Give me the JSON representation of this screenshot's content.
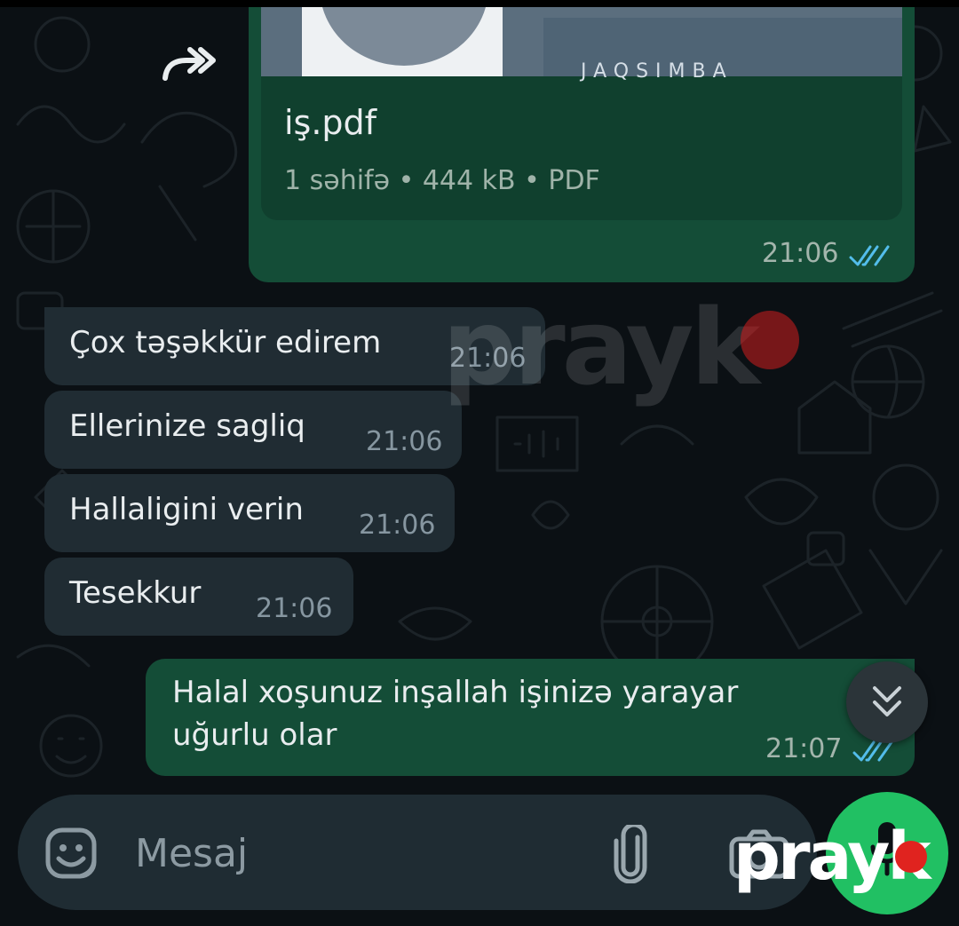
{
  "colors": {
    "background": "#0b1014",
    "outgoing_bubble": "#144d37",
    "incoming_bubble": "#202c33",
    "read_ticks": "#53bdeb",
    "mic_button": "#21c063",
    "watermark_dot": "#e0231f"
  },
  "forwarded_file": {
    "icon": "forward-icon",
    "preview_text": "JAQSIMBA",
    "file_name": "iş.pdf",
    "file_meta": "1 səhifə • 444 kB • PDF",
    "time": "21:06",
    "status": "read"
  },
  "messages": [
    {
      "direction": "in",
      "text": "Çox təşəkkür edirem",
      "time": "21:06"
    },
    {
      "direction": "in",
      "text": "Ellerinize sagliq",
      "time": "21:06"
    },
    {
      "direction": "in",
      "text": "Hallaligini verin",
      "time": "21:06"
    },
    {
      "direction": "in",
      "text": "Tesekkur",
      "time": "21:06"
    },
    {
      "direction": "out",
      "text_line1": "Halal xoşunuz inşallah işinizə yarayar",
      "text_line2": "uğurlu olar",
      "time": "21:07",
      "status": "read"
    }
  ],
  "scroll_button": {
    "icon": "double-chevron-down-icon"
  },
  "composer": {
    "placeholder": "Mesaj",
    "sticker_icon": "sticker-icon",
    "attach_icon": "paperclip-icon",
    "camera_icon": "camera-icon",
    "mic_icon": "microphone-icon"
  },
  "watermark": {
    "text": "prayk"
  }
}
